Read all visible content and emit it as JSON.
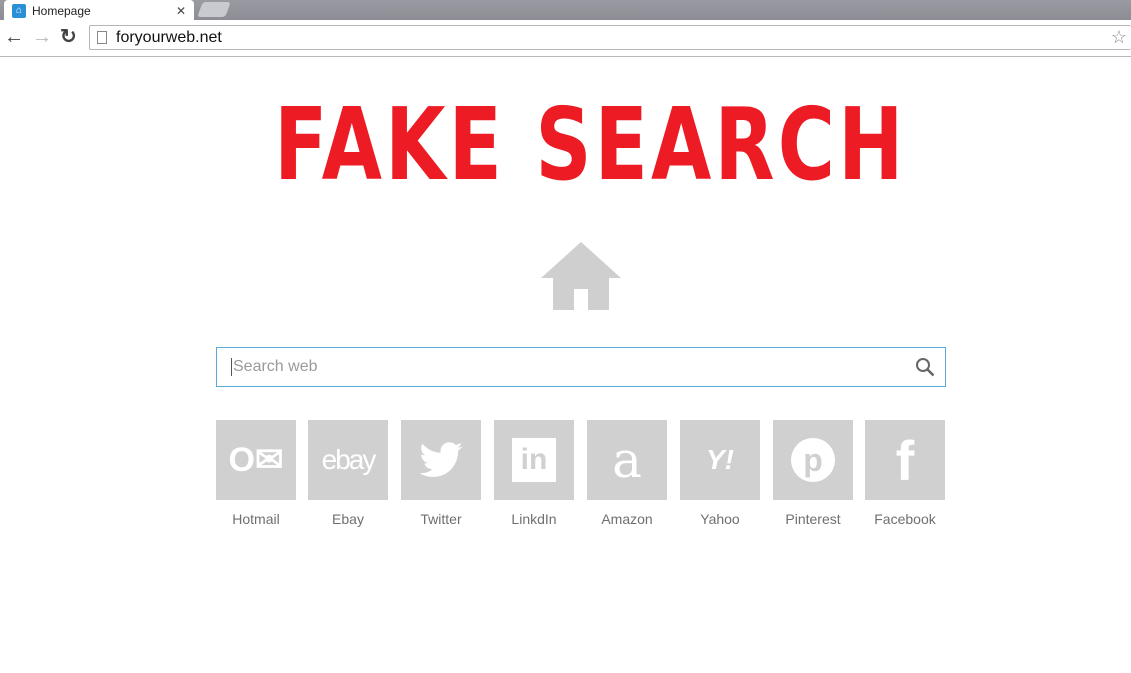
{
  "browser": {
    "tab_title": "Homepage",
    "url": "foryourweb.net"
  },
  "page": {
    "headline": "FAKE SEARCH",
    "search_placeholder": "Search web",
    "shortcuts": [
      {
        "label": "Hotmail",
        "icon": "outlook-icon"
      },
      {
        "label": "Ebay",
        "icon": "ebay-icon"
      },
      {
        "label": "Twitter",
        "icon": "twitter-icon"
      },
      {
        "label": "LinkdIn",
        "icon": "linkedin-icon"
      },
      {
        "label": "Amazon",
        "icon": "amazon-icon"
      },
      {
        "label": "Yahoo",
        "icon": "yahoo-icon"
      },
      {
        "label": "Pinterest",
        "icon": "pinterest-icon"
      },
      {
        "label": "Facebook",
        "icon": "facebook-icon"
      }
    ]
  },
  "colors": {
    "headline": "#ed1c24",
    "tile": "#d0d0d0",
    "search_border": "#5aa9dd"
  }
}
